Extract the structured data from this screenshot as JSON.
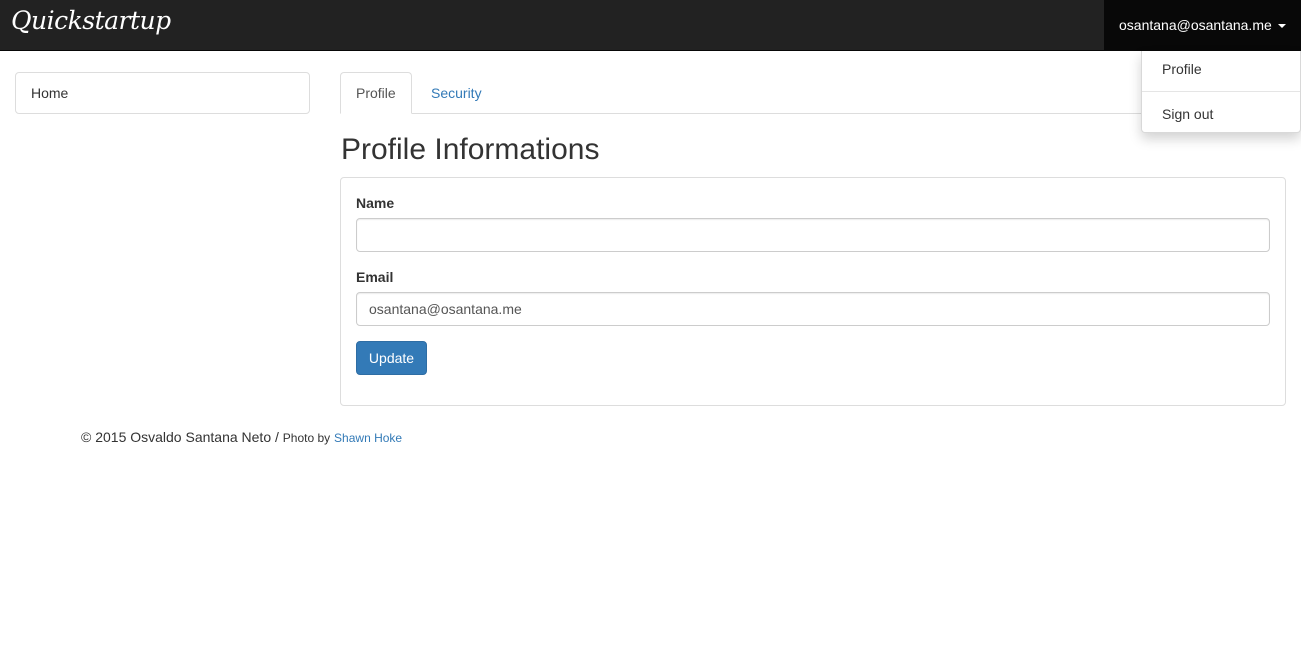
{
  "navbar": {
    "brand": "Quickstartup",
    "user_email": "osantana@osantana.me"
  },
  "dropdown": {
    "items": [
      "Profile",
      "Sign out"
    ]
  },
  "sidebar": {
    "items": [
      {
        "label": "Home"
      }
    ]
  },
  "tabs": [
    {
      "label": "Profile",
      "active": true
    },
    {
      "label": "Security",
      "active": false
    }
  ],
  "main": {
    "title": "Profile Informations",
    "form": {
      "name_label": "Name",
      "name_value": "",
      "email_label": "Email",
      "email_value": "osantana@osantana.me",
      "submit_label": "Update"
    }
  },
  "footer": {
    "copyright": "© 2015 Osvaldo Santana Neto /",
    "photo_by": "Photo by",
    "photo_author": "Shawn Hoke"
  },
  "colors": {
    "navbar_bg": "#222222",
    "accent": "#337ab7"
  }
}
